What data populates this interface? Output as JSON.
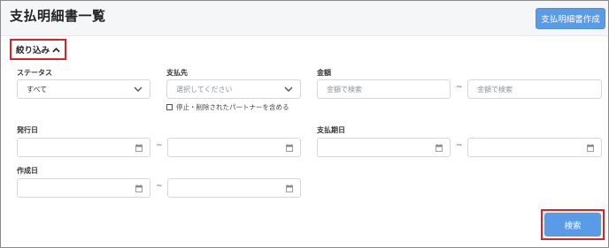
{
  "header": {
    "title": "支払明細書一覧",
    "create_button": "支払明細書作成"
  },
  "filter": {
    "toggle_label": "絞り込み",
    "status": {
      "label": "ステータス",
      "value": "すべて"
    },
    "payee": {
      "label": "支払先",
      "placeholder": "選択してください",
      "include_label": "停止・削除されたパートナーを含める",
      "include_checked": false
    },
    "amount": {
      "label": "金額",
      "from_placeholder": "金額で検索",
      "to_placeholder": "金額で検索",
      "separator": "~"
    },
    "issue_date": {
      "label": "発行日",
      "separator": "~"
    },
    "payment_date": {
      "label": "支払期日",
      "separator": "~"
    },
    "created_date": {
      "label": "作成日",
      "separator": "~"
    },
    "search_button": "検索"
  },
  "icons": {
    "toggle": "chevron-up-icon",
    "dropdown": "chevron-down-icon",
    "date": "calendar-icon"
  },
  "colors": {
    "primary": "#5a9be8",
    "highlight": "#d9222a"
  }
}
